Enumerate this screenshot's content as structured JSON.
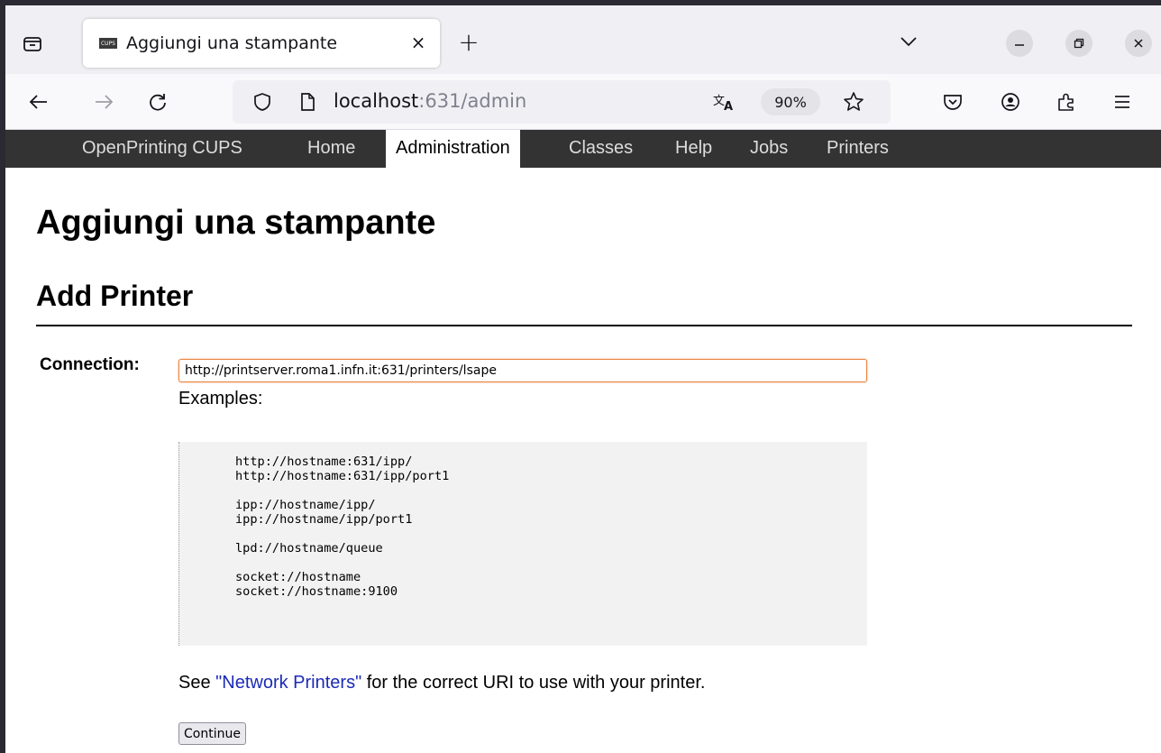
{
  "browser": {
    "tab": {
      "favicon_text": "CUPS",
      "title": "Aggiungi una stampante",
      "close_glyph": "×"
    },
    "new_tab_glyph": "+",
    "url": {
      "host": "localhost",
      "path": ":631/admin"
    },
    "zoom": "90%"
  },
  "cups_nav": {
    "items": [
      {
        "label": "OpenPrinting CUPS"
      },
      {
        "label": "Home"
      },
      {
        "label": "Administration"
      },
      {
        "label": "Classes"
      },
      {
        "label": "Help"
      },
      {
        "label": "Jobs"
      },
      {
        "label": "Printers"
      }
    ],
    "active": "Administration"
  },
  "page": {
    "h1": "Aggiungi una stampante",
    "h2": "Add Printer",
    "connection_label": "Connection:",
    "connection_value": "http://printserver.roma1.infn.it:631/printers/lsape",
    "examples_label": "Examples:",
    "examples": [
      [
        "http://hostname:631/ipp/",
        "http://hostname:631/ipp/port1"
      ],
      [
        "ipp://hostname/ipp/",
        "ipp://hostname/ipp/port1"
      ],
      [
        "lpd://hostname/queue"
      ],
      [
        "socket://hostname",
        "socket://hostname:9100"
      ]
    ],
    "see_prefix": "See ",
    "see_link": "\"Network Printers\"",
    "see_suffix": " for the correct URI to use with your printer.",
    "continue_label": "Continue"
  },
  "colors": {
    "cups_nav_bg": "#333333",
    "link": "#1b2ab6",
    "input_focus": "#e8843e"
  }
}
